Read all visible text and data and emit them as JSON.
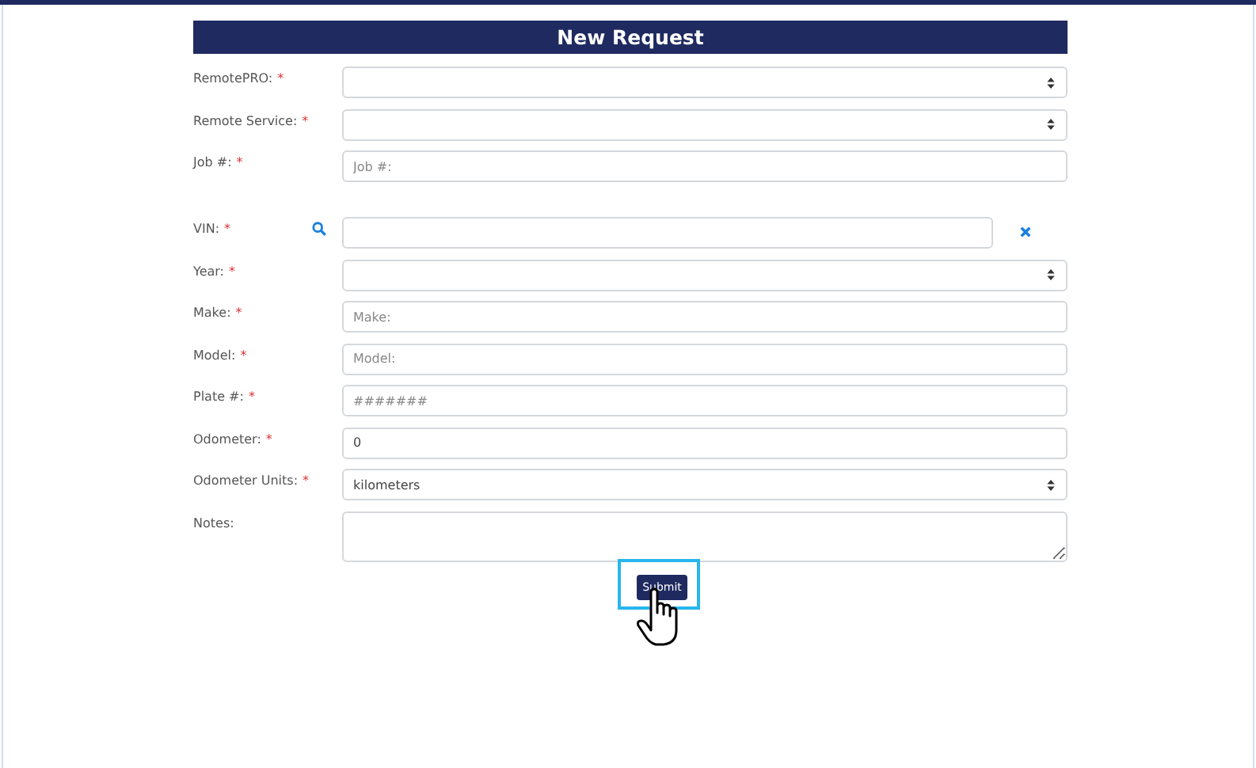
{
  "form": {
    "title": "New Request",
    "sections": [
      [
        {
          "label": "RemotePRO:",
          "required_mark": "*",
          "kind": "select"
        },
        {
          "label": "Remote Service:",
          "required_mark": "*",
          "kind": "select"
        },
        {
          "label": "Job #:",
          "required_mark": "*",
          "kind": "input",
          "placeholder": "Job #:"
        }
      ],
      [
        {
          "label": "VIN:",
          "required_mark": "*",
          "kind": "vin"
        },
        {
          "label": "Year:",
          "required_mark": "*",
          "kind": "select"
        },
        {
          "label": "Make:",
          "required_mark": "*",
          "kind": "input",
          "placeholder": "Make:"
        },
        {
          "label": "Model:",
          "required_mark": "*",
          "kind": "input",
          "placeholder": "Model:"
        },
        {
          "label": "Plate #:",
          "required_mark": "*",
          "kind": "input",
          "placeholder": "#######"
        },
        {
          "label": "Odometer:",
          "required_mark": "*",
          "kind": "input",
          "value": "0"
        },
        {
          "label": "Odometer Units:",
          "required_mark": "*",
          "kind": "select",
          "value": "kilometers"
        },
        {
          "label": "Notes:",
          "kind": "textarea"
        }
      ]
    ],
    "submit": {
      "label": "Submit",
      "highlighted": true
    }
  }
}
